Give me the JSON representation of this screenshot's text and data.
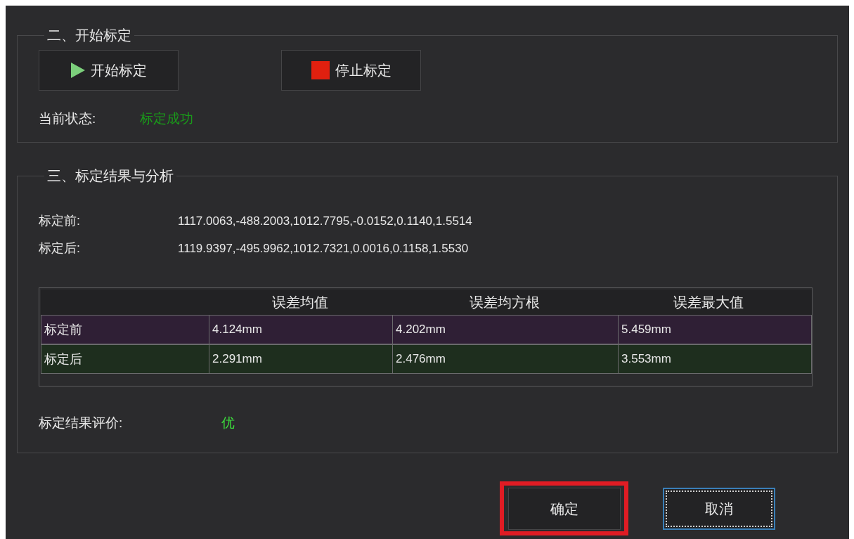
{
  "section_start": {
    "title": "二、开始标定",
    "buttons": [
      {
        "kind": "start",
        "label": "开始标定"
      },
      {
        "kind": "stop",
        "label": "停止标定"
      }
    ],
    "status_label": "当前状态:",
    "status_value": "标定成功"
  },
  "section_result": {
    "title": "三、标定结果与分析",
    "params": [
      {
        "label": "标定前:",
        "value": "1117.0063,-488.2003,1012.7795,-0.0152,0.1140,1.5514"
      },
      {
        "label": "标定后:",
        "value": "1119.9397,-495.9962,1012.7321,0.0016,0.1158,1.5530"
      }
    ],
    "table": {
      "columns": [
        "误差均值",
        "误差均方根",
        "误差最大值"
      ],
      "rows": [
        {
          "label": "标定前",
          "color": "#2f1f35",
          "cells": [
            "4.124mm",
            "4.202mm",
            "5.459mm"
          ]
        },
        {
          "label": "标定后",
          "color": "#1e2e1e",
          "cells": [
            "2.291mm",
            "2.476mm",
            "3.553mm"
          ]
        }
      ]
    },
    "rating_label": "标定结果评价:",
    "rating_value": "优"
  },
  "buttons": [
    {
      "label": "确定",
      "highlighted": true,
      "focused": false
    },
    {
      "label": "取消",
      "highlighted": false,
      "focused": true
    }
  ]
}
